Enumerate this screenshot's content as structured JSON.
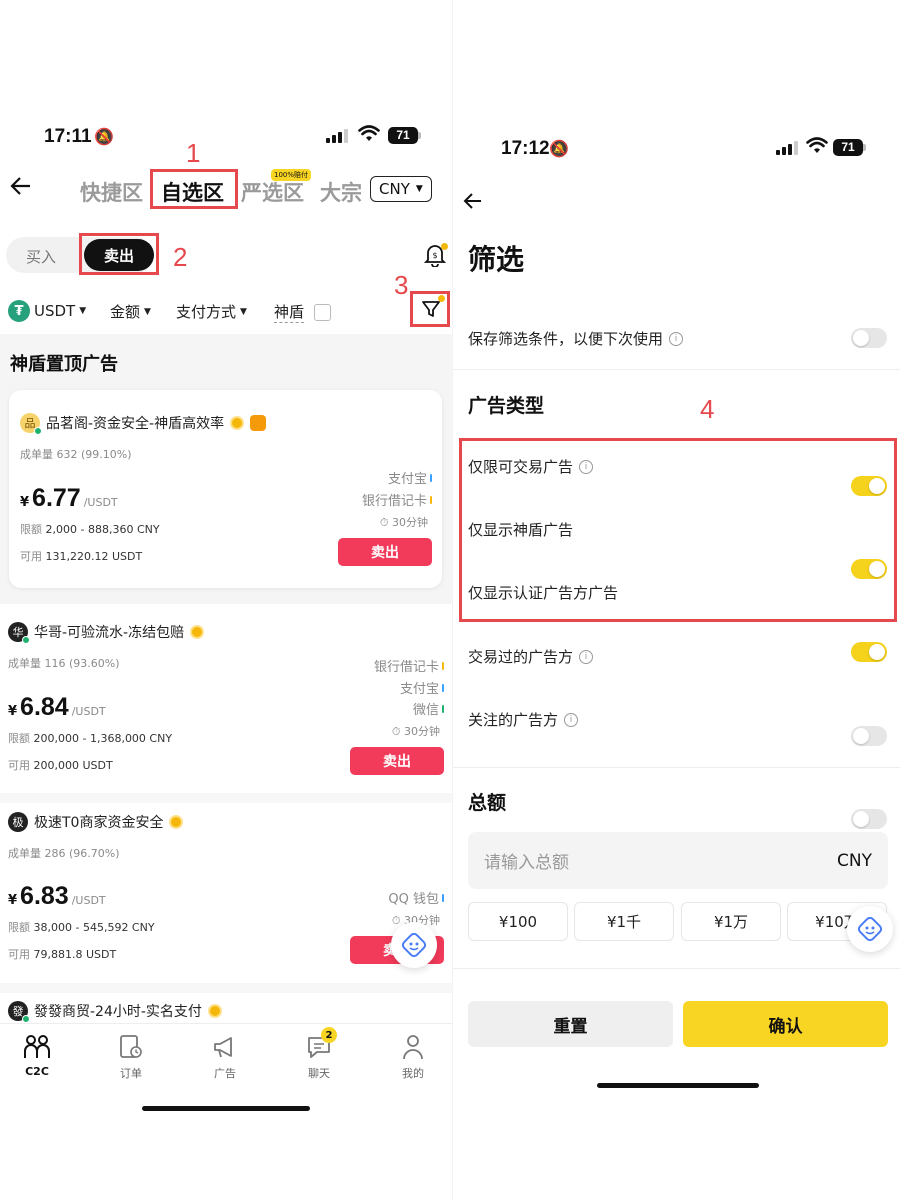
{
  "left": {
    "status": {
      "time": "17:11",
      "battery": "71"
    },
    "tabs": [
      "快捷区",
      "自选区",
      "严选区",
      "大宗"
    ],
    "yanxuan_badge": "100%赔付",
    "currency": "CNY",
    "buy": "买入",
    "sell": "卖出",
    "filters": {
      "coin": "USDT",
      "amount": "金额",
      "pay": "支付方式",
      "shield": "神盾"
    },
    "section_title": "神盾置顶广告",
    "annotations": [
      "1",
      "2",
      "3"
    ],
    "labels": {
      "volume": "成单量",
      "limit": "限额",
      "available": "可用",
      "unit": "/USDT",
      "yen": "¥",
      "sell_btn": "卖出"
    },
    "ads": [
      {
        "avatar": "品",
        "name": "品茗阁-资金安全-神盾高效率",
        "volume": "632 (99.10%)",
        "price": "6.77",
        "limit": "2,000 - 888,360 CNY",
        "available": "131,220.12 USDT",
        "pay": [
          "支付宝",
          "银行借记卡"
        ],
        "time": "30分钟"
      },
      {
        "avatar": "华",
        "name": "华哥-可验流水-冻结包赔",
        "volume": "116 (93.60%)",
        "price": "6.84",
        "limit": "200,000 - 1,368,000 CNY",
        "available": "200,000 USDT",
        "pay": [
          "银行借记卡",
          "支付宝",
          "微信"
        ],
        "time": "30分钟"
      },
      {
        "avatar": "极",
        "name": "极速T0商家资金安全",
        "volume": "286 (96.70%)",
        "price": "6.83",
        "limit": "38,000 - 545,592 CNY",
        "available": "79,881.8 USDT",
        "pay": [
          "QQ 钱包"
        ],
        "time": "30分钟"
      },
      {
        "avatar": "發",
        "name": "發發商贸-24小时-实名支付"
      }
    ],
    "nav": [
      {
        "label": "C2C",
        "icon": "people-icon"
      },
      {
        "label": "订单",
        "icon": "order-icon"
      },
      {
        "label": "广告",
        "icon": "megaphone-icon"
      },
      {
        "label": "聊天",
        "icon": "chat-icon",
        "badge": "2"
      },
      {
        "label": "我的",
        "icon": "profile-icon"
      }
    ]
  },
  "right": {
    "status": {
      "time": "17:12",
      "battery": "71"
    },
    "title": "筛选",
    "save_filter": "保存筛选条件，以便下次使用",
    "ad_type_title": "广告类型",
    "annotation": "4",
    "toggles": [
      {
        "label": "仅限可交易广告",
        "info": true,
        "on": true
      },
      {
        "label": "仅显示神盾广告",
        "info": false,
        "on": true
      },
      {
        "label": "仅显示认证广告方广告",
        "info": false,
        "on": true
      },
      {
        "label": "交易过的广告方",
        "info": true,
        "on": false
      },
      {
        "label": "关注的广告方",
        "info": true,
        "on": false
      }
    ],
    "total_title": "总额",
    "total_placeholder": "请输入总额",
    "total_currency": "CNY",
    "chips": [
      "¥100",
      "¥1千",
      "¥1万",
      "¥10万"
    ],
    "reset": "重置",
    "confirm": "确认"
  }
}
